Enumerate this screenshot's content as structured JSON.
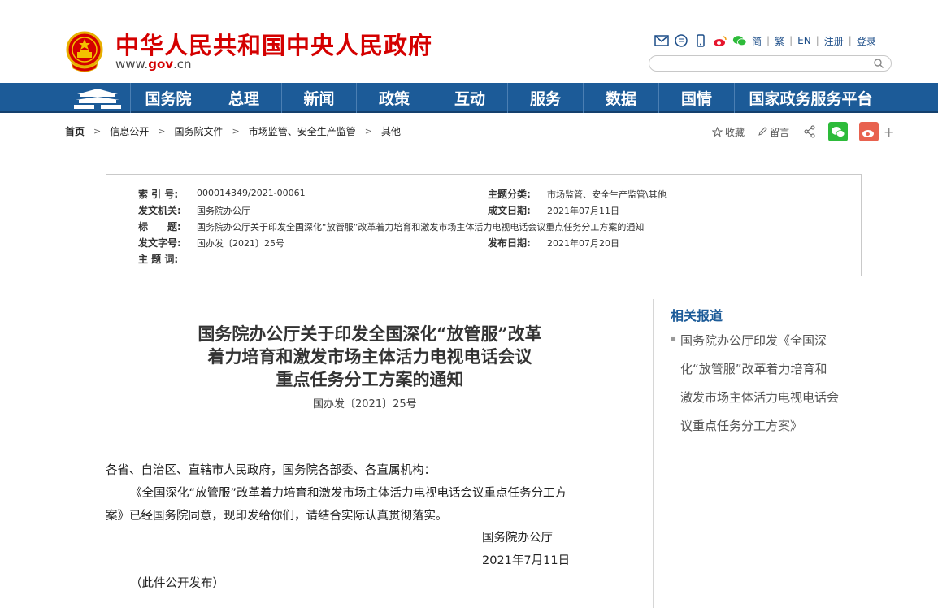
{
  "header": {
    "site_title": "中华人民共和国中央人民政府",
    "url_prefix": "www.",
    "url_gov": "gov",
    "url_suffix": ".cn",
    "links": [
      "简",
      "繁",
      "EN",
      "注册",
      "登录"
    ],
    "search_placeholder": ""
  },
  "nav": {
    "items": [
      "国务院",
      "总理",
      "新闻",
      "政策",
      "互动",
      "服务",
      "数据",
      "国情",
      "国家政务服务平台"
    ]
  },
  "breadcrumb": [
    "首页",
    "信息公开",
    "国务院文件",
    "市场监管、安全生产监管",
    "其他"
  ],
  "tools": {
    "favorite": "收藏",
    "comment": "留言"
  },
  "meta": {
    "index_label": "索 引 号:",
    "index_value": "000014349/2021-00061",
    "topic_label": "主题分类:",
    "topic_value": "市场监管、安全生产监管\\其他",
    "issuer_label": "发文机关:",
    "issuer_value": "国务院办公厅",
    "created_label": "成文日期:",
    "created_value": "2021年07月11日",
    "title_label": "标　　题:",
    "title_value": "国务院办公厅关于印发全国深化“放管服”改革着力培育和激发市场主体活力电视电话会议重点任务分工方案的通知",
    "docno_label": "发文字号:",
    "docno_value": "国办发〔2021〕25号",
    "published_label": "发布日期:",
    "published_value": "2021年07月20日",
    "keywords_label": "主 题 词:",
    "keywords_value": ""
  },
  "article": {
    "title_line1": "国务院办公厅关于印发全国深化“放管服”改革",
    "title_line2": "着力培育和激发市场主体活力电视电话会议",
    "title_line3": "重点任务分工方案的通知",
    "doc_number": "国办发〔2021〕25号",
    "salutation": "各省、自治区、直辖市人民政府，国务院各部委、各直属机构：",
    "para1_line1": "《全国深化“放管服”改革着力培育和激发市场主体活力电视电话会议重点任务分工方",
    "para1_line2": "案》已经国务院同意，现印发给你们，请结合实际认真贯彻落实。",
    "signature": "国务院办公厅",
    "date": "2021年7月11日",
    "note": "（此件公开发布）"
  },
  "sidebar": {
    "title": "相关报道",
    "link_lines": [
      "国务院办公厅印发《全国深",
      "化“放管服”改革着力培育和",
      "激发市场主体活力电视电话会",
      "议重点任务分工方案》"
    ]
  },
  "colors": {
    "brand_red": "#d40000",
    "nav_blue": "#1c5b98"
  }
}
